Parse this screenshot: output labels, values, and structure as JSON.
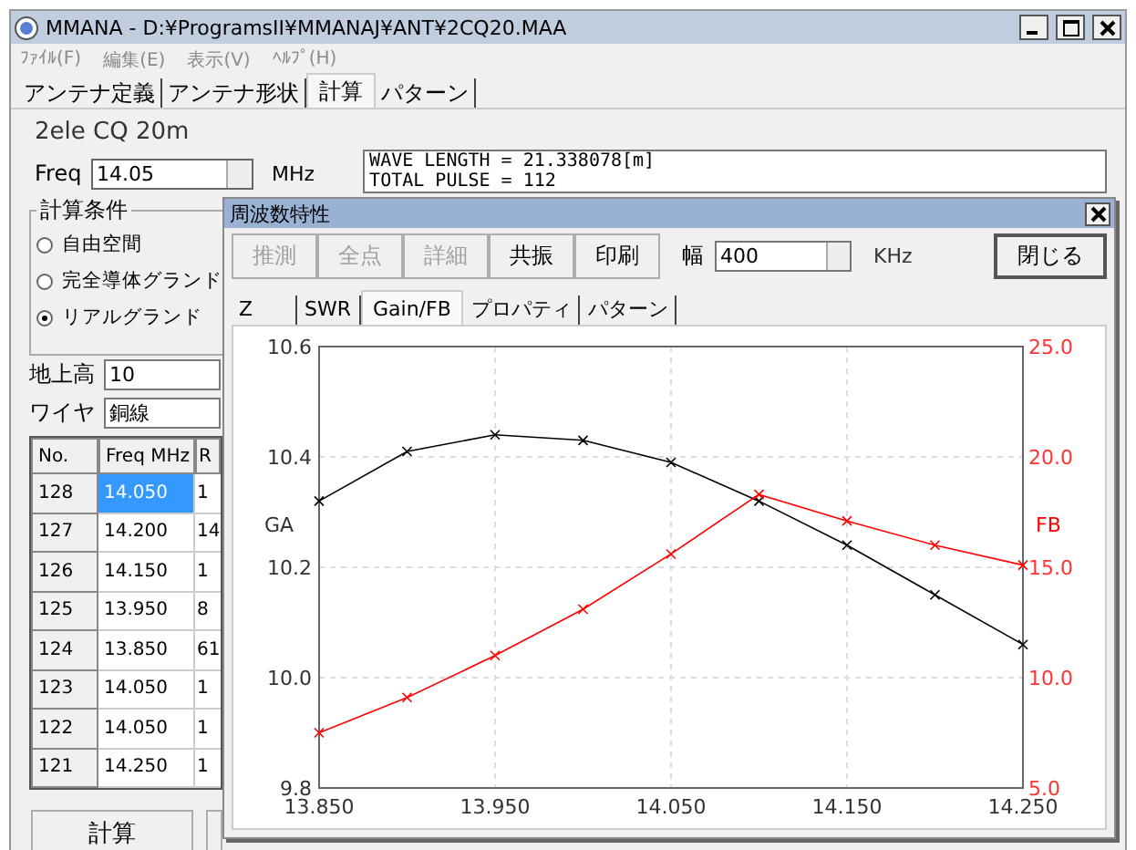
{
  "window": {
    "title": "MMANA - D:¥ProgramsII¥MMANAJ¥ANT¥2CQ20.MAA"
  },
  "menu": [
    "ﾌｧｲﾙ(F)",
    "編集(E)",
    "表示(V)",
    "ﾍﾙﾌﾟ(H)"
  ],
  "tabs": [
    {
      "label": "アンテナ定義",
      "selected": false
    },
    {
      "label": "アンテナ形状",
      "selected": false
    },
    {
      "label": "計算",
      "selected": true
    },
    {
      "label": "パターン",
      "selected": false
    }
  ],
  "calc": {
    "antenna_name": "2ele CQ 20m",
    "freq_label": "Freq",
    "freq_value": "14.05",
    "freq_unit": "MHz",
    "info_lines": [
      "WAVE LENGTH = 21.338078[m]",
      "TOTAL PULSE = 112"
    ],
    "conditions": {
      "title": "計算条件",
      "options": [
        {
          "label": "自由空間",
          "selected": false
        },
        {
          "label": "完全導体グランド",
          "selected": false
        },
        {
          "label": "リアルグランド",
          "selected": true
        }
      ]
    },
    "height_label": "地上高",
    "height_value": "10",
    "wire_label": "ワイヤ",
    "wire_value": "銅線",
    "table": {
      "columns": [
        "No.",
        "Freq MHz",
        "R"
      ],
      "rows": [
        {
          "cells": [
            "128",
            "14.050",
            "1"
          ],
          "selected": true
        },
        {
          "cells": [
            "127",
            "14.200",
            "14"
          ],
          "selected": false
        },
        {
          "cells": [
            "126",
            "14.150",
            "1"
          ],
          "selected": false
        },
        {
          "cells": [
            "125",
            "13.950",
            "8"
          ],
          "selected": false
        },
        {
          "cells": [
            "124",
            "13.850",
            "61"
          ],
          "selected": false
        },
        {
          "cells": [
            "123",
            "14.050",
            "1"
          ],
          "selected": false
        },
        {
          "cells": [
            "122",
            "14.050",
            "1"
          ],
          "selected": false
        },
        {
          "cells": [
            "121",
            "14.250",
            "1"
          ],
          "selected": false
        }
      ]
    },
    "buttons": [
      {
        "kind": "labelled",
        "label": "計算"
      },
      {
        "kind": "covered"
      }
    ]
  },
  "dialog": {
    "title": "周波数特性",
    "toolbar": [
      {
        "label": "推測",
        "disabled": true
      },
      {
        "label": "全点",
        "disabled": true
      },
      {
        "label": "詳細",
        "disabled": true
      },
      {
        "label": "共振",
        "disabled": false
      },
      {
        "label": "印刷",
        "disabled": false
      }
    ],
    "width_label": "幅",
    "width_value": "400",
    "width_unit": "KHz",
    "close_label": "閉じる",
    "tabs": [
      {
        "label": "Z",
        "selected": false
      },
      {
        "label": "SWR",
        "selected": false
      },
      {
        "label": "Gain/FB",
        "selected": true
      },
      {
        "label": "プロパティ",
        "selected": false
      },
      {
        "label": "パターン",
        "selected": false
      }
    ],
    "chart_data": {
      "type": "line",
      "grid": true,
      "x": [
        13.85,
        13.9,
        13.95,
        14.0,
        14.05,
        14.1,
        14.15,
        14.2,
        14.25
      ],
      "series": [
        {
          "name": "GA",
          "color": "#000000",
          "marker": "x",
          "values": [
            10.32,
            10.41,
            10.44,
            10.43,
            10.39,
            10.32,
            10.24,
            10.15,
            10.06
          ]
        },
        {
          "name": "FB",
          "color": "#ff0000",
          "axis": "y2",
          "marker": "x",
          "values": [
            7.5,
            9.1,
            11.0,
            13.1,
            15.6,
            18.3,
            17.1,
            16.0,
            15.1
          ]
        }
      ],
      "xlim": [
        13.85,
        14.25
      ],
      "ylim": [
        9.8,
        10.6
      ],
      "y2lim": [
        5,
        25
      ],
      "xticks": [
        {
          "value": 13.85,
          "label": "13.850"
        },
        {
          "value": 13.95,
          "label": "13.950"
        },
        {
          "value": 14.05,
          "label": "14.050"
        },
        {
          "value": 14.15,
          "label": "14.150"
        },
        {
          "value": 14.25,
          "label": "14.250"
        }
      ],
      "yticks": [
        {
          "value": 9.8,
          "label": "9.8"
        },
        {
          "value": 10.0,
          "label": "10.0"
        },
        {
          "value": 10.2,
          "label": "10.2"
        },
        {
          "value": 10.4,
          "label": "10.4"
        },
        {
          "value": 10.6,
          "label": "10.6"
        }
      ],
      "y2ticks": [
        {
          "value": 5,
          "label": "5.0"
        },
        {
          "value": 10,
          "label": "10.0"
        },
        {
          "value": 15,
          "label": "15.0"
        },
        {
          "value": 20,
          "label": "20.0"
        },
        {
          "value": 25,
          "label": "25.0"
        }
      ]
    }
  }
}
